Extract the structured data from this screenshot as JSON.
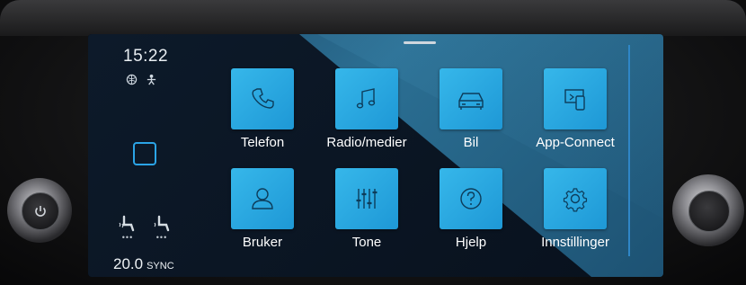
{
  "status": {
    "time": "15:22",
    "icons": [
      "globe-icon",
      "person-icon"
    ]
  },
  "climate": {
    "temperature": "20.0",
    "sync_label": "SYNC",
    "seat_icons": [
      "seat-heating-left-icon",
      "seat-heating-right-icon"
    ]
  },
  "apps": [
    {
      "label": "Telefon",
      "icon": "phone-icon"
    },
    {
      "label": "Radio/medier",
      "icon": "music-note-icon"
    },
    {
      "label": "Bil",
      "icon": "car-icon"
    },
    {
      "label": "App-Connect",
      "icon": "app-connect-icon"
    },
    {
      "label": "Bruker",
      "icon": "user-icon"
    },
    {
      "label": "Tone",
      "icon": "equalizer-icon"
    },
    {
      "label": "Hjelp",
      "icon": "help-icon"
    },
    {
      "label": "Innstillinger",
      "icon": "settings-gear-icon"
    }
  ],
  "colors": {
    "tile": "#2aa9e4",
    "accent": "#2ba4e6",
    "background": "#0a1320"
  }
}
